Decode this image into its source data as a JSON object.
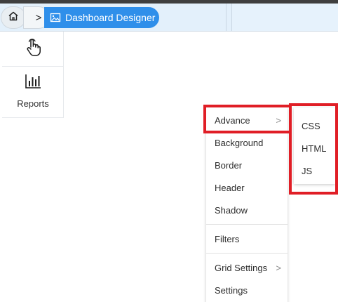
{
  "breadcrumb": {
    "home_icon": "home-icon",
    "chevron": ">",
    "current_label": "Dashboard Designer",
    "current_icon": "image-icon"
  },
  "rail": {
    "pointer_icon": "hand-pointer-icon",
    "reports_icon": "bar-chart-icon",
    "reports_label": "Reports"
  },
  "menu": {
    "items": [
      {
        "label": "Advance",
        "has_submenu": true,
        "submenu_arrow": ">"
      },
      {
        "label": "Background"
      },
      {
        "label": "Border"
      },
      {
        "label": "Header"
      },
      {
        "label": "Shadow"
      },
      {
        "label": "Filters"
      },
      {
        "label": "Grid Settings",
        "has_submenu": true,
        "submenu_arrow": ">"
      },
      {
        "label": "Settings"
      }
    ]
  },
  "submenu": {
    "items": [
      {
        "label": "CSS"
      },
      {
        "label": "HTML"
      },
      {
        "label": "JS"
      }
    ]
  },
  "colors": {
    "accent": "#2f8fea",
    "highlight": "#e01e26",
    "header_bg": "#e3f0fb"
  }
}
